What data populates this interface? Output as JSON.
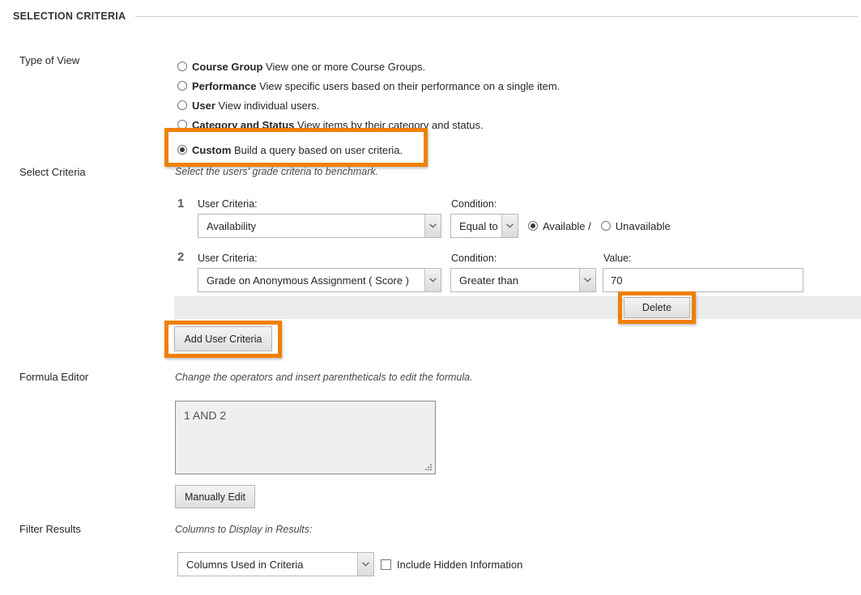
{
  "section": {
    "title": "SELECTION CRITERIA"
  },
  "rows": {
    "type_of_view_label": "Type of View",
    "select_criteria_label": "Select Criteria",
    "formula_editor_label": "Formula Editor",
    "filter_results_label": "Filter Results"
  },
  "type_of_view": {
    "options": [
      {
        "name": "Course Group",
        "desc": "View one or more Course Groups.",
        "selected": false
      },
      {
        "name": "Performance",
        "desc": "View specific users based on their performance on a single item.",
        "selected": false
      },
      {
        "name": "User",
        "desc": "View individual users.",
        "selected": false
      },
      {
        "name": "Category and Status",
        "desc": "View items by their category and status.",
        "selected": false
      },
      {
        "name": "Custom",
        "desc": "Build a query based on user criteria.",
        "selected": true
      }
    ]
  },
  "select_criteria": {
    "hint": "Select the users' grade criteria to benchmark.",
    "user_criteria_label": "User Criteria:",
    "condition_label": "Condition:",
    "value_label": "Value:",
    "rows": [
      {
        "index": "1",
        "criteria_value": "Availability",
        "condition_value": "Equal to",
        "availability": {
          "available_label": "Available /",
          "unavailable_label": "Unavailable",
          "selected": "available"
        }
      },
      {
        "index": "2",
        "criteria_value": "Grade on Anonymous Assignment ( Score )",
        "condition_value": "Greater than",
        "value": "70"
      }
    ],
    "delete_button": "Delete",
    "add_button": "Add User Criteria"
  },
  "formula_editor": {
    "hint": "Change the operators and insert parentheticals to edit the formula.",
    "formula": "1 AND 2",
    "manually_edit_button": "Manually Edit"
  },
  "filter_results": {
    "hint": "Columns to Display in Results:",
    "columns_value": "Columns Used in Criteria",
    "include_hidden_label": "Include Hidden Information"
  },
  "colors": {
    "highlight": "#f08000",
    "grey_bar": "#ececec",
    "text": "#262626"
  }
}
